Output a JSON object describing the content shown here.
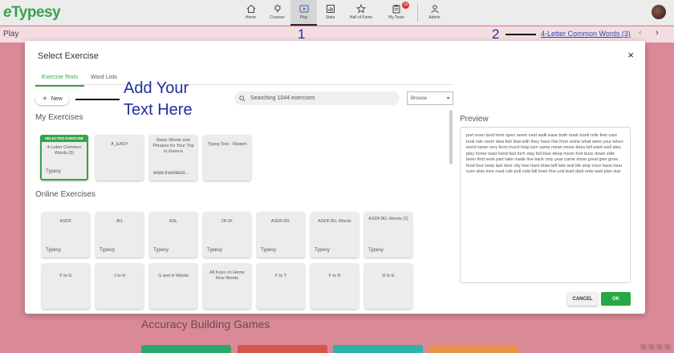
{
  "app": {
    "logo_prefix": "e",
    "logo_rest": "Typesy"
  },
  "nav": {
    "items": [
      {
        "label": "Home",
        "icon": "home-icon"
      },
      {
        "label": "Courses",
        "icon": "lightbulb-icon"
      },
      {
        "label": "Play",
        "icon": "play-icon",
        "active": true
      },
      {
        "label": "Stats",
        "icon": "stats-icon"
      },
      {
        "label": "Hall of Fame",
        "icon": "star-icon"
      },
      {
        "label": "My Tests",
        "icon": "clipboard-icon",
        "badge": "10"
      },
      {
        "label": "Admin",
        "icon": "user-icon"
      }
    ]
  },
  "subbar": {
    "page_label": "Play",
    "annotation_1": "1",
    "annotation_2": "2",
    "exercise_link": "4-Letter Common Words (3)",
    "prev": "‹",
    "next": "›"
  },
  "background": {
    "section_title": "Accuracy Building Games",
    "game_button_colors": [
      "#2aa86a",
      "#d9534f",
      "#2bb3a8",
      "#e8924a"
    ]
  },
  "modal": {
    "title": "Select Exercise",
    "close": "×",
    "tabs": [
      {
        "label": "Exercise Texts",
        "active": true
      },
      {
        "label": "Word Lists",
        "active": false
      }
    ],
    "new_button": {
      "plus": "+",
      "label": "New"
    },
    "annotation_text": "Add Your Text Here",
    "search_placeholder": "Searching 1044 exercises",
    "browse": {
      "value": "Browse",
      "caret": "▾"
    },
    "my_exercises_title": "My Exercises",
    "my_exercises": [
      {
        "title": "4-Letter Common Words (3)",
        "source": "Typesy",
        "selected": true,
        "badge": "SELECTED EXERCISE"
      },
      {
        "title": "A_EASY",
        "source": ""
      },
      {
        "title": "Basic Words and Phrases for Your Trip to Greece",
        "source": "www.traveland..."
      },
      {
        "title": "Typeg Test - 66wpm",
        "source": ""
      }
    ],
    "online_exercises_title": "Online Exercises",
    "online_row_1": [
      {
        "title": "ASDF",
        "source": "Typesy"
      },
      {
        "title": "JKL",
        "source": "Typesy"
      },
      {
        "title": "ASL",
        "source": "Typesy"
      },
      {
        "title": "DFJK",
        "source": "Typesy"
      },
      {
        "title": "ASDFJKL",
        "source": "Typesy"
      },
      {
        "title": "ASDFJKL Words",
        "source": "Typesy"
      },
      {
        "title": "ASDFJKL Words (2)",
        "source": "Typesy"
      }
    ],
    "online_row_2": [
      {
        "title": "F to G",
        "source": ""
      },
      {
        "title": "J to H",
        "source": ""
      },
      {
        "title": "G and H Words",
        "source": ""
      },
      {
        "title": "All Keys on Home Row Words",
        "source": ""
      },
      {
        "title": "F to T",
        "source": ""
      },
      {
        "title": "F to R",
        "source": ""
      },
      {
        "title": "D to E",
        "source": ""
      }
    ],
    "preview_title": "Preview",
    "preview_text": "port even land here open seem next walk ease both mark book mile feet care took rain room idea fish that with they have this from some what were your when word name very form much help turn same mean move does tell want well also play home read hand fact inch stay full blue deep moon foot busy down side been find work part take made live back only year came show good give grow food four keep last door city tree hard draw left late real life stop once base hear sure slow love road rule pull cold fall town fine unit lead dark note wait plan star",
    "cancel_label": "CANCEL",
    "ok_label": "OK"
  }
}
